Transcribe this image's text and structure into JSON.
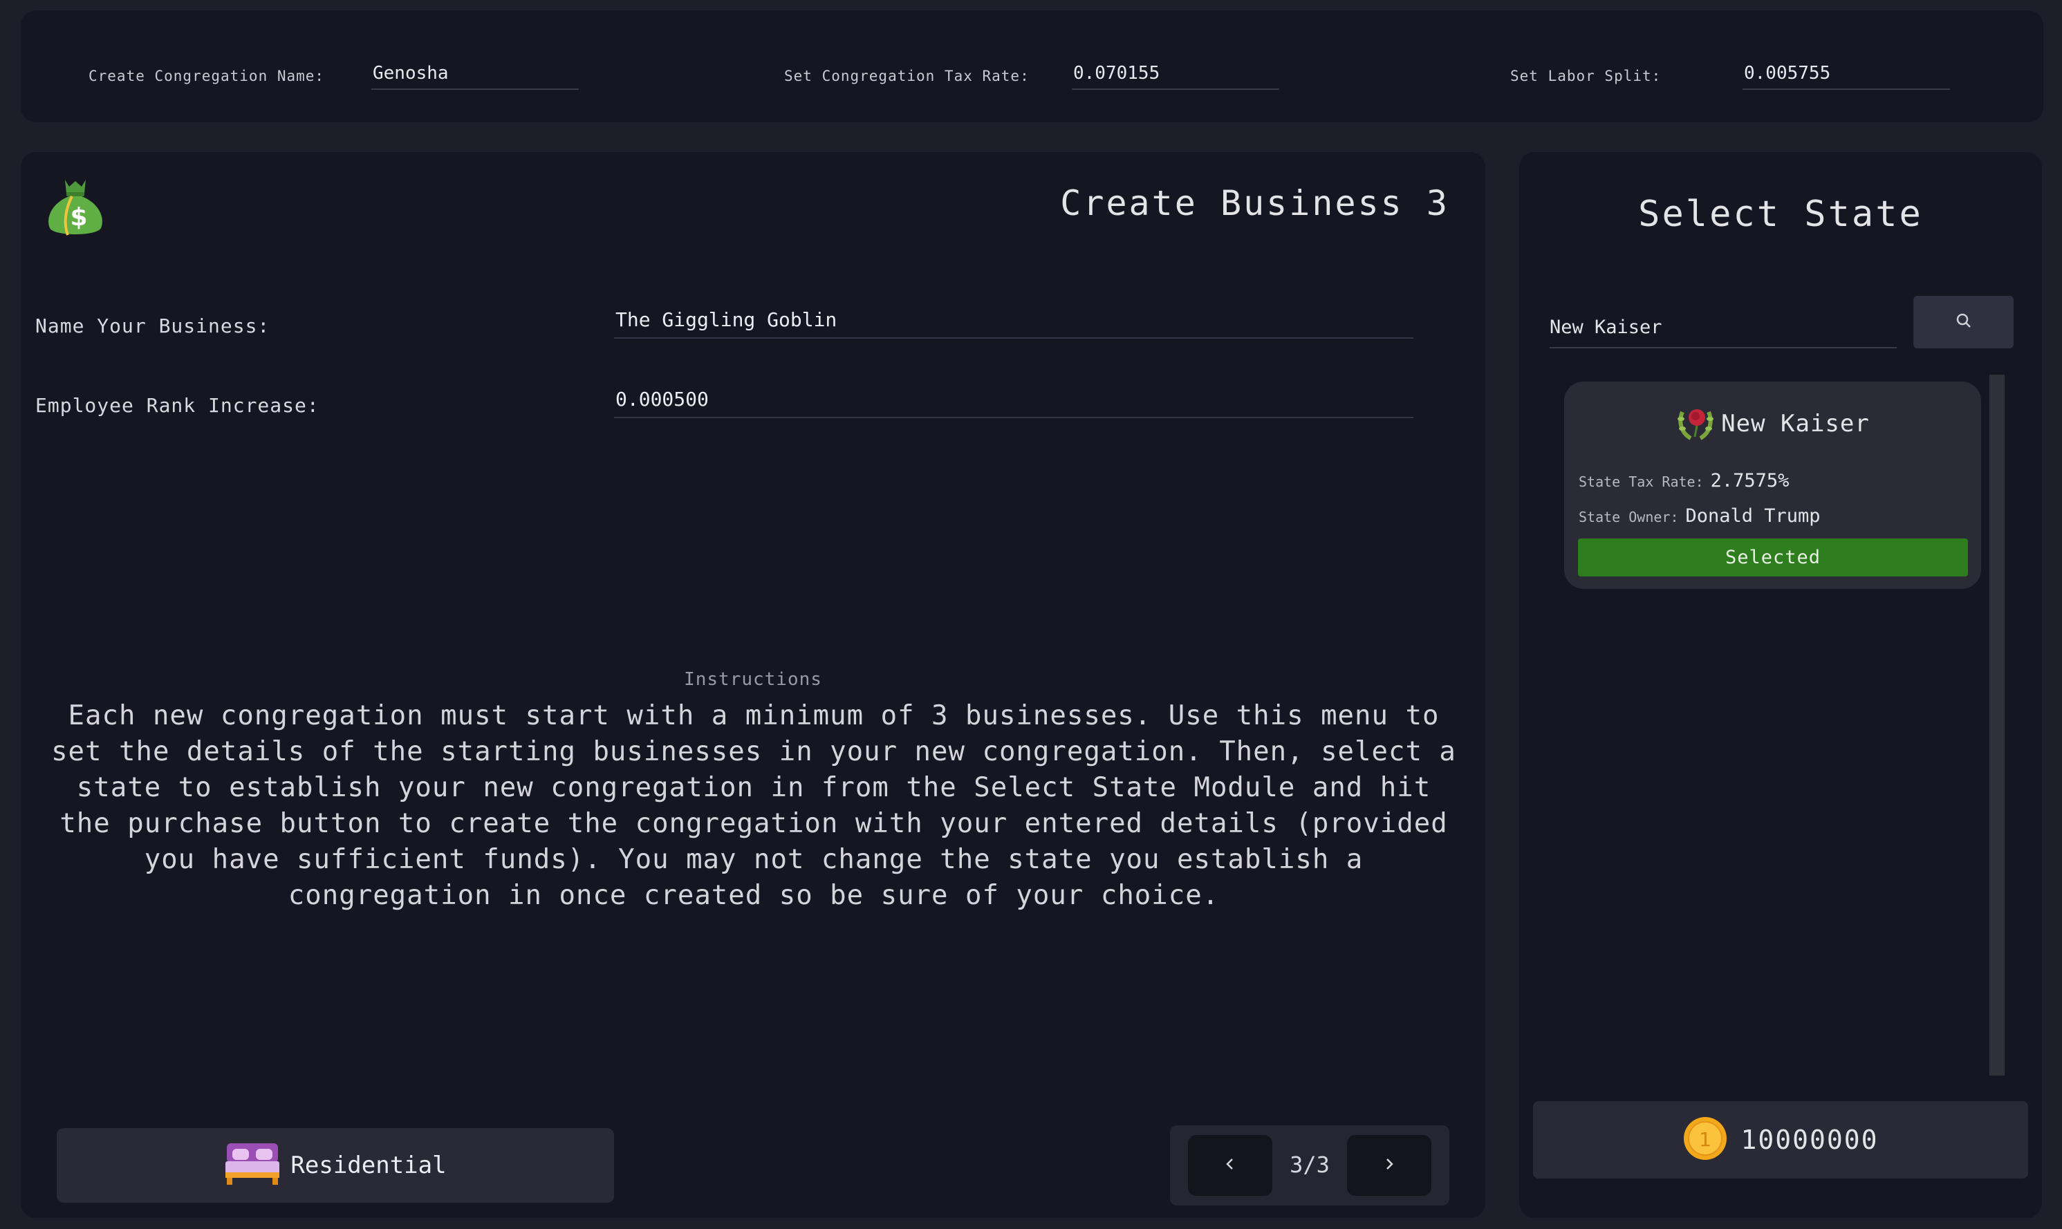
{
  "top_bar": {
    "name_label": "Create Congregation Name:",
    "name_value": "Genosha",
    "tax_label": "Set Congregation Tax Rate:",
    "tax_value": "0.070155",
    "labor_label": "Set Labor Split:",
    "labor_value": "0.005755"
  },
  "business": {
    "icon": "money-bag-icon",
    "title": "Create Business 3",
    "name_label": "Name Your Business:",
    "name_value": "The Giggling Goblin",
    "rank_label": "Employee Rank Increase:",
    "rank_value": "0.000500",
    "instructions_heading": "Instructions",
    "instructions_text": "Each new congregation must start with a minimum of 3 businesses. Use this menu to set the details of the starting businesses in your new congregation. Then, select a state to establish your new congregation in from the Select State Module and hit the purchase button to create the congregation with your entered details (provided you have sufficient funds). You may not change the state you establish a congregation in once created so be sure of your choice.",
    "type_icon": "bed-icon",
    "type_label": "Residential",
    "pager_label": "3/3"
  },
  "state_select": {
    "title": "Select State",
    "search_value": "New Kaiser",
    "search_icon": "search-icon",
    "card": {
      "emblem_icon": "rose-wreath-icon",
      "name": "New Kaiser",
      "tax_label": "State Tax Rate:",
      "tax_value": "2.7575%",
      "owner_label": "State Owner:",
      "owner_value": "Donald Trump",
      "button_label": "Selected"
    },
    "coin_icon": "coin-icon",
    "funds": "10000000"
  },
  "colors": {
    "background": "#1d1e28",
    "panel": "#161622",
    "selected_green": "#2e7d1f"
  }
}
